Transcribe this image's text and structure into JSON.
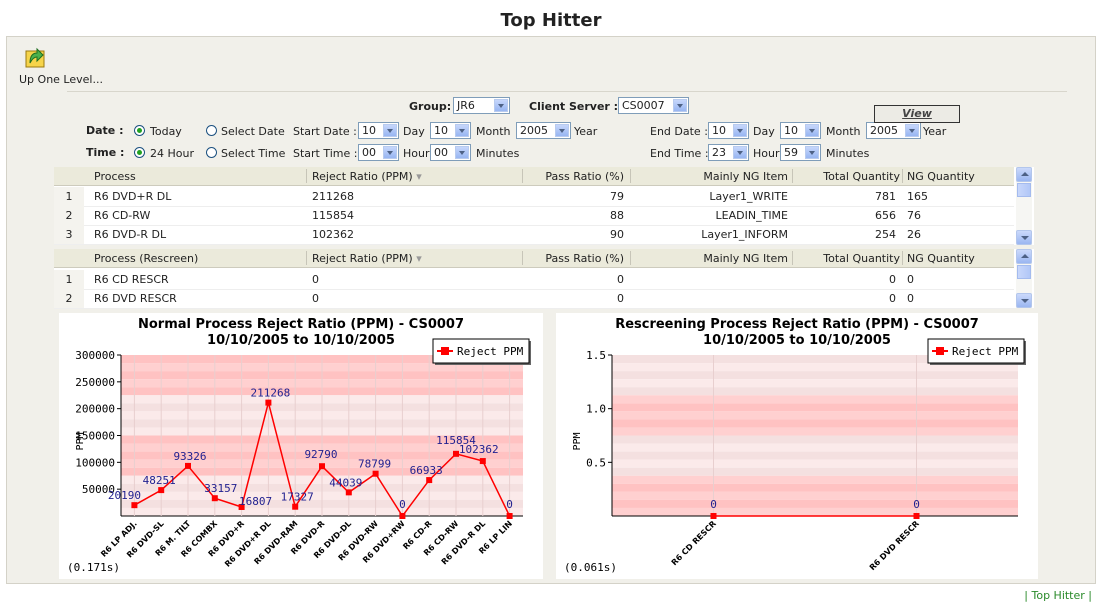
{
  "page": {
    "title": "Top Hitter"
  },
  "nav": {
    "up_label": "Up One Level..."
  },
  "filters": {
    "group_label": "Group:",
    "group_value": "JR6",
    "client_server_label": "Client Server :",
    "client_server_value": "CS0007",
    "date_label": "Date :",
    "time_label": "Time :",
    "today_label": "Today",
    "select_date_label": "Select Date",
    "hour24_label": "24 Hour",
    "select_time_label": "Select Time",
    "start_date_label": "Start Date :",
    "start_time_label": "Start Time :",
    "end_date_label": "End Date :",
    "end_time_label": "End Time :",
    "day_label": "Day",
    "month_label": "Month",
    "year_label": "Year",
    "hour_label": "Hour",
    "minutes_label": "Minutes",
    "start_day": "10",
    "start_month": "10",
    "start_year": "2005",
    "start_hour": "00",
    "start_minutes": "00",
    "end_day": "10",
    "end_month": "10",
    "end_year": "2005",
    "end_hour": "23",
    "end_minutes": "59",
    "view_label": "View"
  },
  "normal_table": {
    "headers": [
      "Process",
      "Reject Ratio (PPM)",
      "Pass Ratio (%)",
      "Mainly NG Item",
      "Total Quantity",
      "NG Quantity"
    ],
    "rows": [
      [
        "1",
        "R6 DVD+R DL",
        "211268",
        "79",
        "Layer1_WRITE",
        "781",
        "165"
      ],
      [
        "2",
        "R6 CD-RW",
        "115854",
        "88",
        "LEADIN_TIME",
        "656",
        "76"
      ],
      [
        "3",
        "R6 DVD-R DL",
        "102362",
        "90",
        "Layer1_INFORM",
        "254",
        "26"
      ]
    ]
  },
  "rescreen_table": {
    "headers": [
      "Process (Rescreen)",
      "Reject Ratio (PPM)",
      "Pass Ratio (%)",
      "Mainly NG Item",
      "Total Quantity",
      "NG Quantity"
    ],
    "rows": [
      [
        "1",
        "R6 CD RESCR",
        "0",
        "0",
        "",
        "0",
        "0"
      ],
      [
        "2",
        "R6 DVD RESCR",
        "0",
        "0",
        "",
        "0",
        "0"
      ]
    ]
  },
  "chart_data": [
    {
      "type": "line",
      "title": "Normal Process Reject Ratio (PPM) - CS0007",
      "subtitle": "10/10/2005 to 10/10/2005",
      "ylabel": "PPM",
      "ylim": [
        0,
        300000
      ],
      "yticks": [
        50000,
        100000,
        150000,
        200000,
        250000,
        300000
      ],
      "ytick_labels": [
        "50000",
        "100000",
        "150000",
        "200000",
        "250000",
        "300000"
      ],
      "categories": [
        "R6 LP ADJ.",
        "R6 DVD-SL",
        "R6 M. TILT",
        "R6 COMBX",
        "R6 DVD+R",
        "R6 DVD+R DL",
        "R6 DVD-RAM",
        "R6 DVD-R",
        "R6 DVD-DL",
        "R6 DVD-RW",
        "R6 DVD+RW",
        "R6 CD-R",
        "R6 CD-RW",
        "R6 DVD-R DL",
        "R6 LP LIN"
      ],
      "series": [
        {
          "name": "Reject PPM",
          "values": [
            20190,
            48251,
            93326,
            33157,
            16807,
            211268,
            17327,
            92790,
            44039,
            78799,
            0,
            66933,
            115854,
            102362,
            0
          ]
        }
      ],
      "legend": "top-right",
      "timing": "(0.171s)",
      "color": "#ff0000"
    },
    {
      "type": "line",
      "title": "Rescreening Process Reject Ratio (PPM) - CS0007",
      "subtitle": "10/10/2005 to 10/10/2005",
      "ylabel": "PPM",
      "ylim": [
        0,
        1.5
      ],
      "yticks": [
        0.5,
        1.0,
        1.5
      ],
      "ytick_labels": [
        "0.5",
        "1.0",
        "1.5"
      ],
      "categories": [
        "R6 CD RESCR",
        "R6 DVD RESCR"
      ],
      "series": [
        {
          "name": "Reject PPM",
          "values": [
            0,
            0
          ]
        }
      ],
      "legend": "top-right",
      "timing": "(0.061s)",
      "color": "#ff0000"
    }
  ],
  "footer": {
    "link": "| Top Hitter |"
  }
}
